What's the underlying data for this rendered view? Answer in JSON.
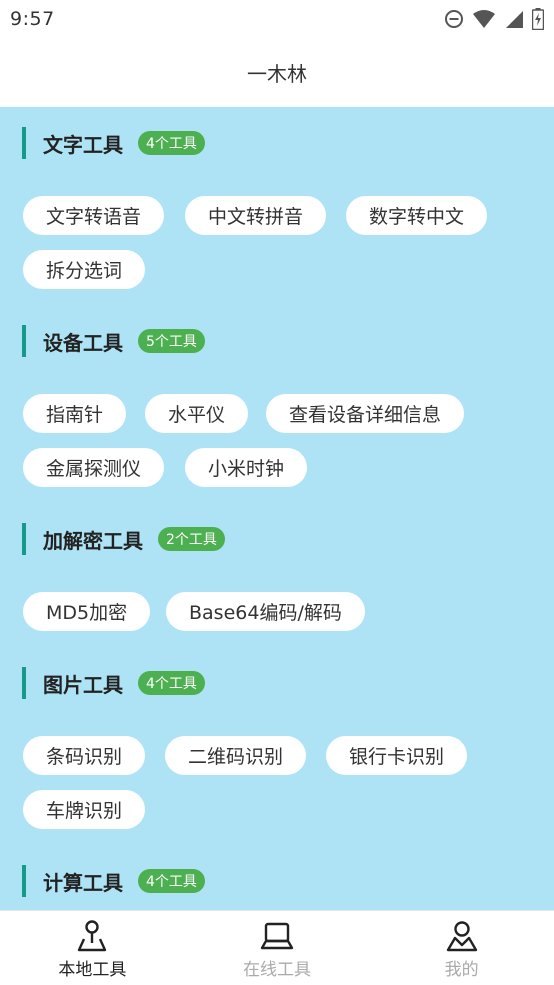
{
  "status_bar": {
    "time": "9:57"
  },
  "header": {
    "title": "一木林"
  },
  "sections": [
    {
      "title": "文字工具",
      "badge": "4个工具",
      "tools": [
        "文字转语音",
        "中文转拼音",
        "数字转中文",
        "拆分选词"
      ]
    },
    {
      "title": "设备工具",
      "badge": "5个工具",
      "tools": [
        "指南针",
        "水平仪",
        "查看设备详细信息",
        "金属探测仪",
        "小米时钟"
      ]
    },
    {
      "title": "加解密工具",
      "badge": "2个工具",
      "tools": [
        "MD5加密",
        "Base64编码/解码"
      ]
    },
    {
      "title": "图片工具",
      "badge": "4个工具",
      "tools": [
        "条码识别",
        "二维码识别",
        "银行卡识别",
        "车牌识别"
      ]
    },
    {
      "title": "计算工具",
      "badge": "4个工具",
      "tools": []
    }
  ],
  "bottom_nav": [
    {
      "label": "本地工具",
      "icon": "map-pin-icon",
      "active": true
    },
    {
      "label": "在线工具",
      "icon": "laptop-icon",
      "active": false
    },
    {
      "label": "我的",
      "icon": "user-icon",
      "active": false
    }
  ],
  "colors": {
    "content_bg": "#aee3f6",
    "section_bar": "#159a8a",
    "badge": "#4caf50"
  }
}
